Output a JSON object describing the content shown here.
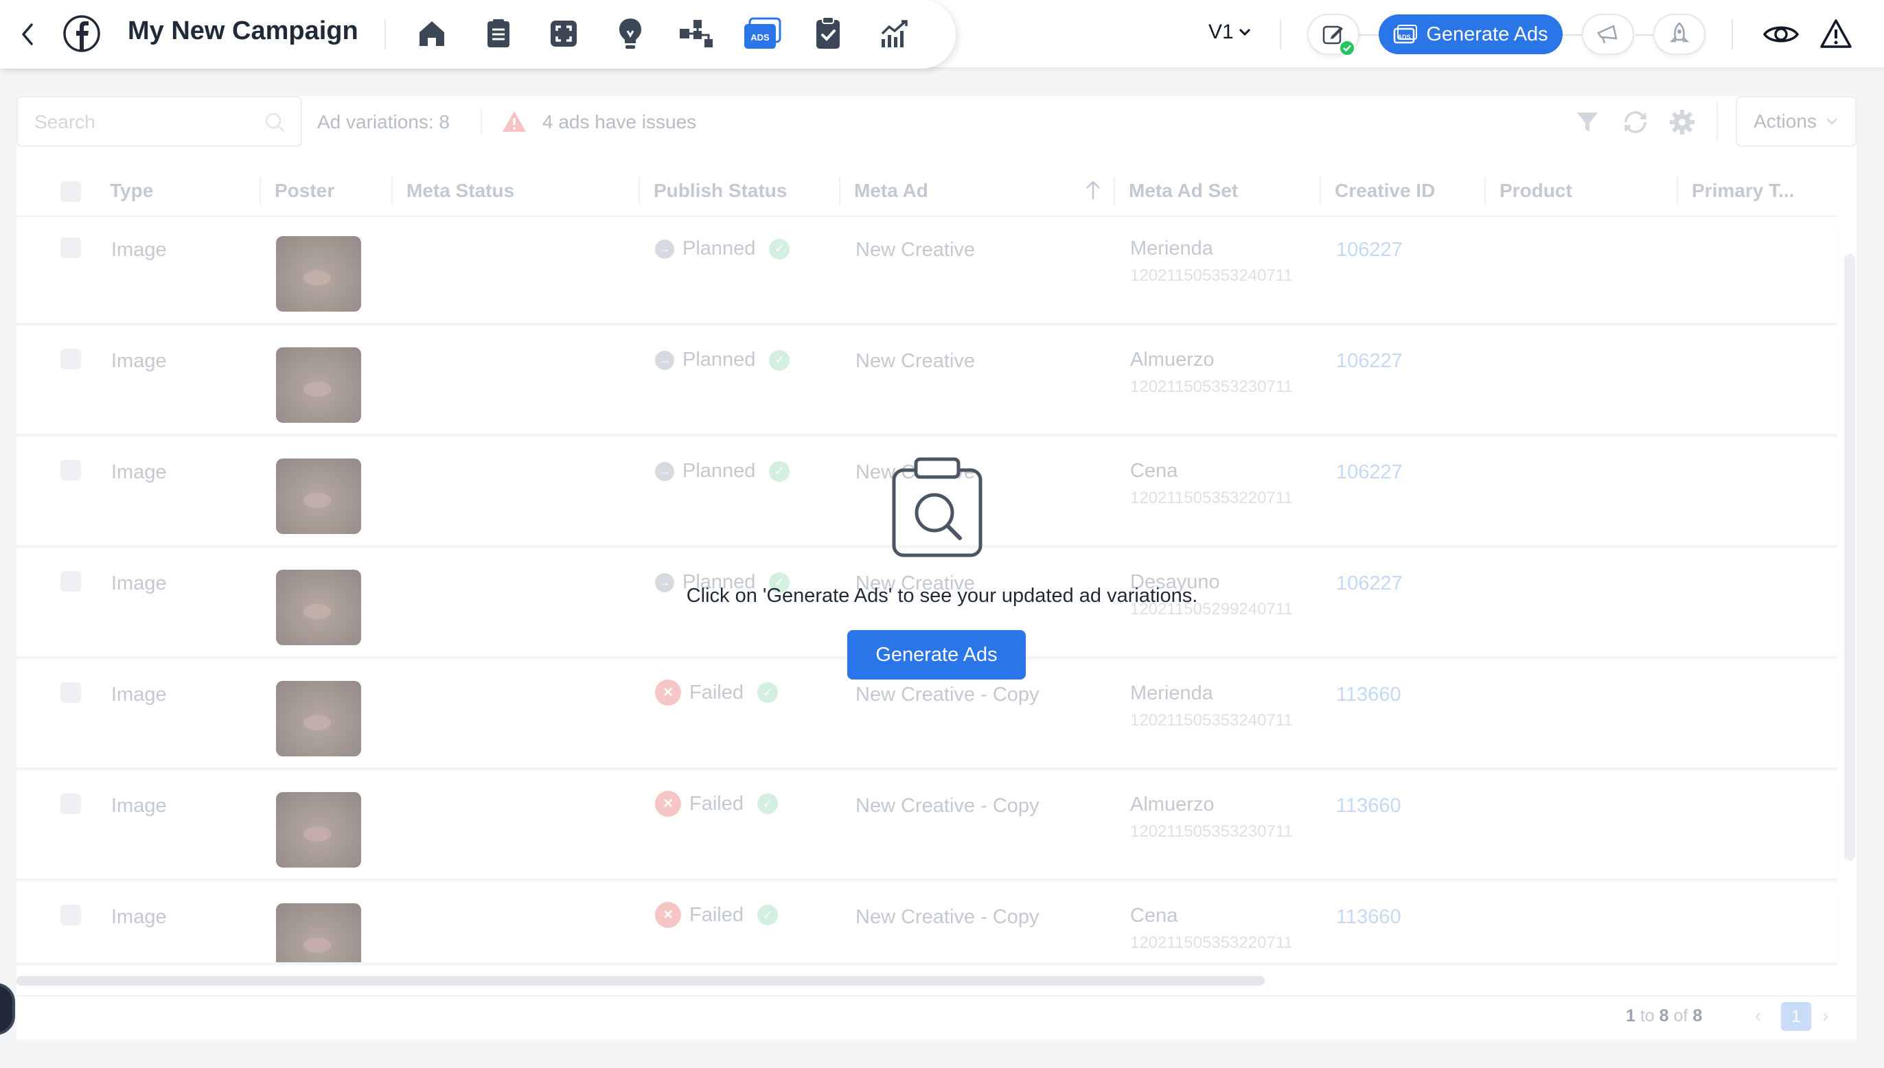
{
  "header": {
    "title": "My New Campaign",
    "version": "V1",
    "generate_label": "Generate Ads",
    "nav_icons": [
      "home-icon",
      "document-icon",
      "frame-icon",
      "lightbulb-icon",
      "flow-icon",
      "ads-icon",
      "clipboard-check-icon",
      "analytics-icon"
    ],
    "ads_badge": "ADS"
  },
  "toolbar": {
    "search_placeholder": "Search",
    "variations": "Ad variations: 8",
    "issues": "4 ads have issues",
    "actions_label": "Actions"
  },
  "columns": [
    "Type",
    "Poster",
    "Meta Status",
    "Publish Status",
    "Meta Ad",
    "Meta Ad Set",
    "Creative ID",
    "Product",
    "Primary T..."
  ],
  "rows": [
    {
      "type": "Image",
      "status": "Planned",
      "ad": "New Creative",
      "set": "Merienda",
      "set_id": "120211505353240711",
      "creative_id": "106227"
    },
    {
      "type": "Image",
      "status": "Planned",
      "ad": "New Creative",
      "set": "Almuerzo",
      "set_id": "120211505353230711",
      "creative_id": "106227"
    },
    {
      "type": "Image",
      "status": "Planned",
      "ad": "New Creative",
      "set": "Cena",
      "set_id": "120211505353220711",
      "creative_id": "106227"
    },
    {
      "type": "Image",
      "status": "Planned",
      "ad": "New Creative",
      "set": "Desayuno",
      "set_id": "120211505299240711",
      "creative_id": "106227"
    },
    {
      "type": "Image",
      "status": "Failed",
      "ad": "New Creative - Copy",
      "set": "Merienda",
      "set_id": "120211505353240711",
      "creative_id": "113660"
    },
    {
      "type": "Image",
      "status": "Failed",
      "ad": "New Creative - Copy",
      "set": "Almuerzo",
      "set_id": "120211505353230711",
      "creative_id": "113660"
    },
    {
      "type": "Image",
      "status": "Failed",
      "ad": "New Creative - Copy",
      "set": "Cena",
      "set_id": "120211505353220711",
      "creative_id": "113660"
    }
  ],
  "overlay": {
    "message": "Click on 'Generate Ads' to see your updated ad variations.",
    "button": "Generate Ads"
  },
  "pagination": {
    "from": "1",
    "to_word": "to",
    "to": "8",
    "of_word": "of",
    "total": "8",
    "page": "1"
  },
  "colors": {
    "accent": "#2a75e8",
    "success": "#22c55e",
    "danger": "#ef4444"
  }
}
